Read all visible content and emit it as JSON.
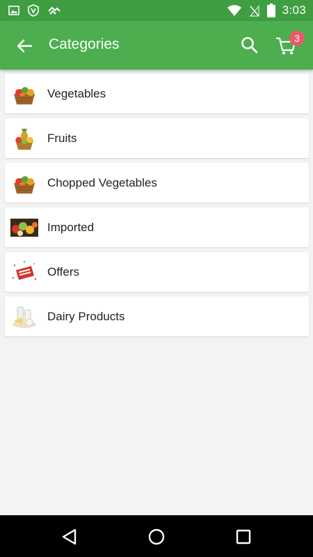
{
  "status_bar": {
    "time": "3:03",
    "left_icons": [
      "image-icon",
      "shield-icon",
      "sync-icon"
    ],
    "right_icons": [
      "wifi-icon",
      "no-sim-icon",
      "battery-icon"
    ]
  },
  "toolbar": {
    "title": "Categories",
    "back_icon": "arrow-left-icon",
    "search_icon": "search-icon",
    "cart_icon": "cart-icon",
    "cart_count": "3",
    "background": "#4cae4f",
    "status_background": "#3f9e42",
    "badge_color": "#e75a6c"
  },
  "categories": [
    {
      "label": "Vegetables",
      "icon": "vegetable-basket-icon"
    },
    {
      "label": "Fruits",
      "icon": "fruit-basket-icon"
    },
    {
      "label": "Chopped Vegetables",
      "icon": "vegetable-basket-icon"
    },
    {
      "label": "Imported",
      "icon": "imported-fruits-icon"
    },
    {
      "label": "Offers",
      "icon": "offer-tag-icon"
    },
    {
      "label": "Dairy Products",
      "icon": "dairy-icon"
    }
  ],
  "nav_bar": {
    "back": "nav-back-icon",
    "home": "nav-home-icon",
    "recents": "nav-recents-icon"
  }
}
